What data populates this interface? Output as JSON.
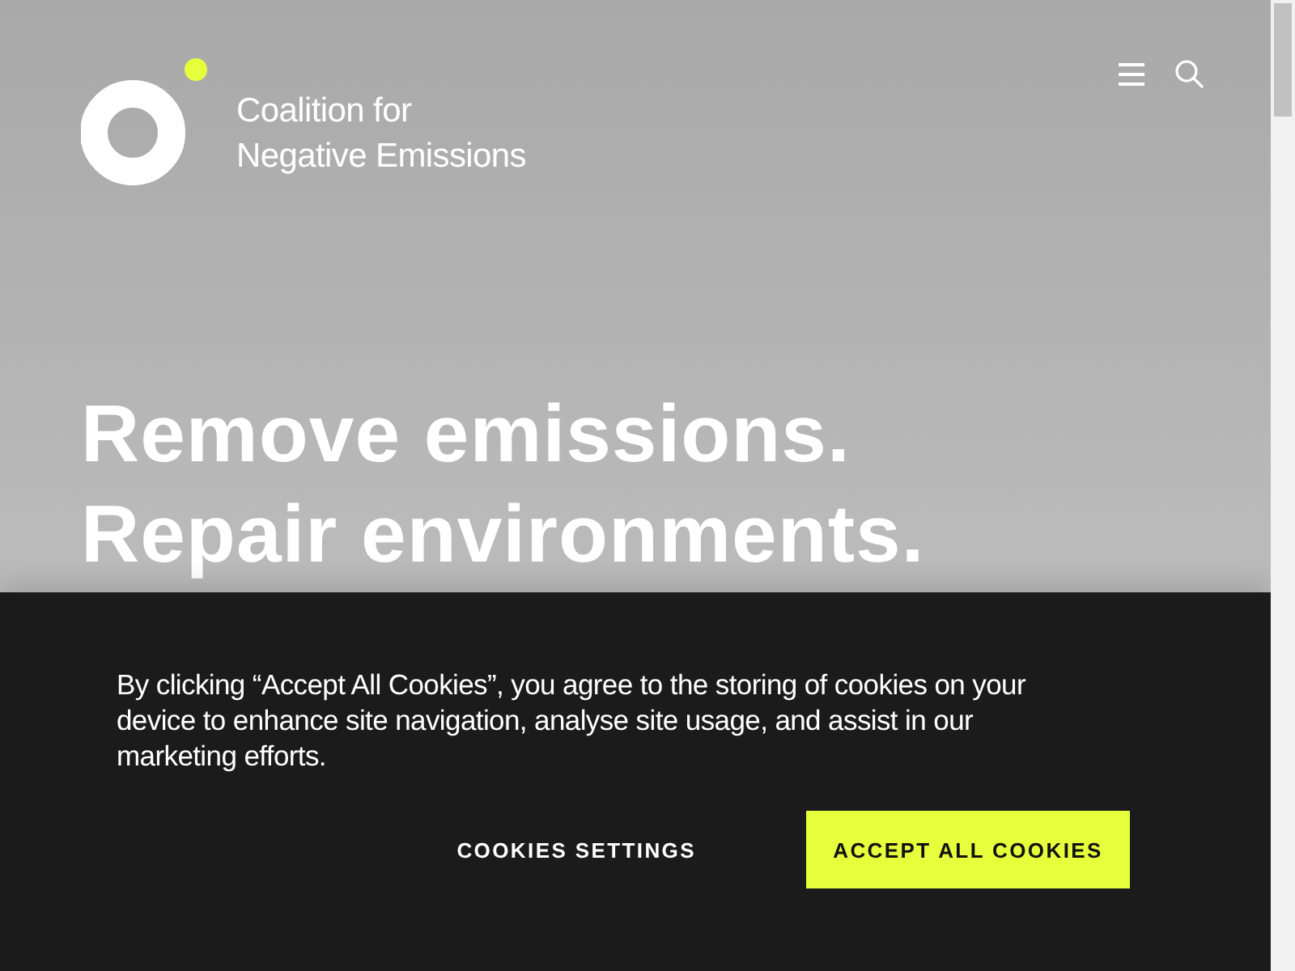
{
  "header": {
    "logo_text": [
      "Coalition for",
      "Negative Emissions"
    ]
  },
  "hero": {
    "headline": [
      "Remove emissions.",
      "Repair environments."
    ]
  },
  "cookie_banner": {
    "message": "By clicking “Accept All Cookies”, you agree to the storing of cookies on your device to enhance site navigation, analyse site usage, and assist in our marketing efforts.",
    "settings_button": "COOKIES SETTINGS",
    "accept_button": "ACCEPT ALL COOKIES"
  }
}
